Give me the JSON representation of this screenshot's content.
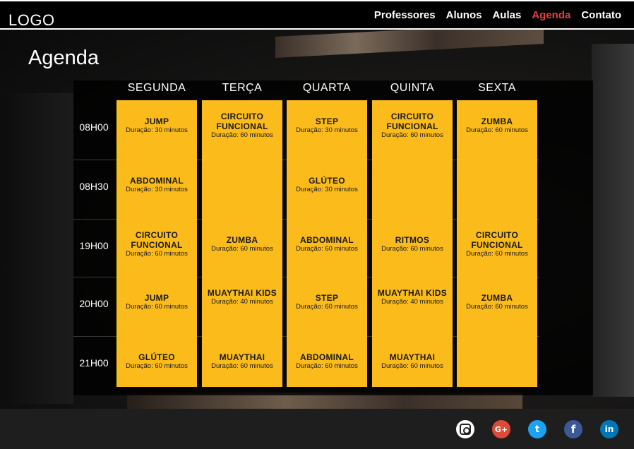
{
  "header": {
    "logo": "LOGO",
    "nav": [
      {
        "label": "Professores",
        "active": false
      },
      {
        "label": "Alunos",
        "active": false
      },
      {
        "label": "Aulas",
        "active": false
      },
      {
        "label": "Agenda",
        "active": true
      },
      {
        "label": "Contato",
        "active": false
      }
    ],
    "active_color": "#e8403b"
  },
  "page": {
    "title": "Agenda"
  },
  "schedule": {
    "cell_color": "#fbbb1a",
    "days": [
      "SEGUNDA",
      "TERÇA",
      "QUARTA",
      "QUINTA",
      "SEXTA"
    ],
    "times": [
      "08H00",
      "08H30",
      "19H00",
      "20H00",
      "21H00"
    ],
    "columns": [
      [
        {
          "name": "JUMP",
          "duration": "Duração: 30 minutos"
        },
        {
          "name": "ABDOMINAL",
          "duration": "Duração: 30 minutos"
        },
        {
          "name": "CIRCUITO FUNCIONAL",
          "duration": "Duração: 60 minutos"
        },
        {
          "name": "JUMP",
          "duration": "Duração: 60 minutos"
        },
        {
          "name": "GLÚTEO",
          "duration": "Duração: 60 minutos"
        }
      ],
      [
        {
          "name": "CIRCUITO FUNCIONAL",
          "duration": "Duração: 60 minutos"
        },
        null,
        {
          "name": "ZUMBA",
          "duration": "Duração: 60 minutos"
        },
        {
          "name": "MUAYTHAI KIDS",
          "duration": "Duração: 40 minutos"
        },
        {
          "name": "MUAYTHAI",
          "duration": "Duração: 60 minutos"
        }
      ],
      [
        {
          "name": "STEP",
          "duration": "Duração: 30 minutos"
        },
        {
          "name": "GLÚTEO",
          "duration": "Duração: 30 minutos"
        },
        {
          "name": "ABDOMINAL",
          "duration": "Duração: 60 minutos"
        },
        {
          "name": "STEP",
          "duration": "Duração: 60 minutos"
        },
        {
          "name": "ABDOMINAL",
          "duration": "Duração: 60 minutos"
        }
      ],
      [
        {
          "name": "CIRCUITO FUNCIONAL",
          "duration": "Duração: 60 minutos"
        },
        null,
        {
          "name": "RITMOS",
          "duration": "Duração: 60 minutos"
        },
        {
          "name": "MUAYTHAI KIDS",
          "duration": "Duração: 40 minutos"
        },
        {
          "name": "MUAYTHAI",
          "duration": "Duração: 60 minutos"
        }
      ],
      [
        {
          "name": "ZUMBA",
          "duration": "Duração: 60 minutos"
        },
        null,
        {
          "name": "CIRCUITO FUNCIONAL",
          "duration": "Duração: 60 minutos"
        },
        {
          "name": "ZUMBA",
          "duration": "Duração: 60 minutos"
        },
        null
      ]
    ]
  },
  "footer": {
    "social": [
      {
        "icon": "instagram-icon",
        "glyph": ""
      },
      {
        "icon": "google-plus-icon",
        "glyph": "G+"
      },
      {
        "icon": "twitter-icon",
        "glyph": "t"
      },
      {
        "icon": "facebook-icon",
        "glyph": "f"
      },
      {
        "icon": "linkedin-icon",
        "glyph": "in"
      }
    ]
  }
}
